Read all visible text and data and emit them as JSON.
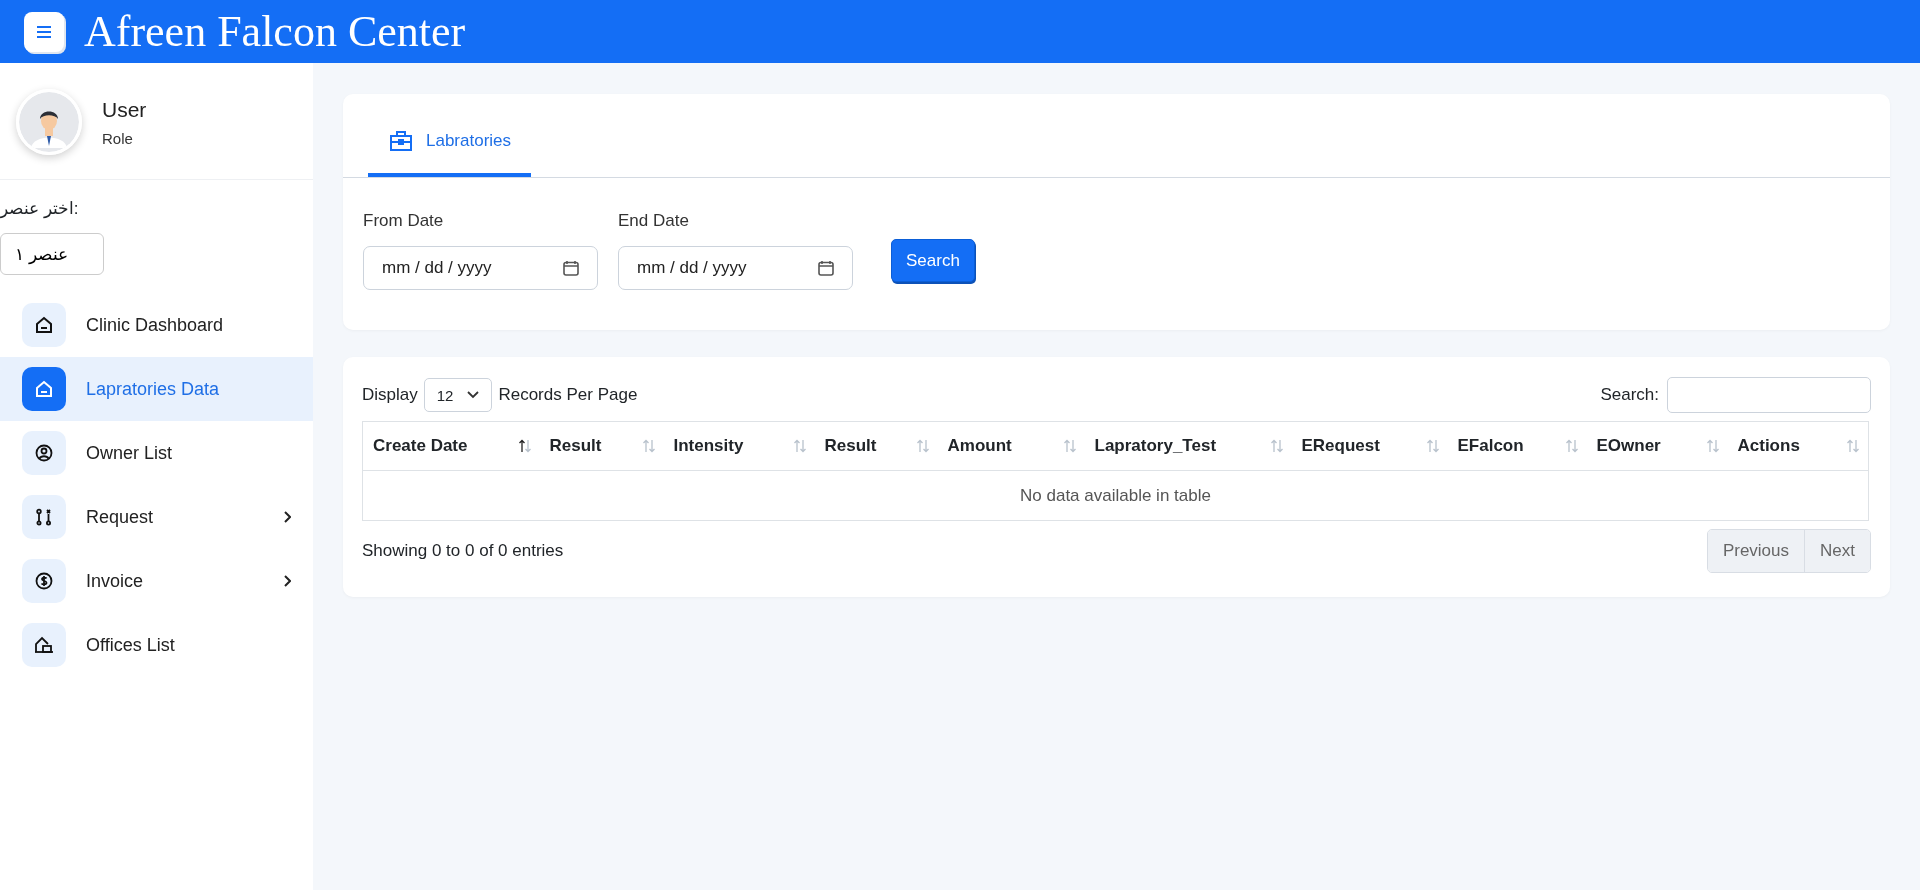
{
  "header": {
    "title": "Afreen Falcon Center"
  },
  "user": {
    "name": "User",
    "role": "Role"
  },
  "picker": {
    "label": "اختر عنصر:",
    "value": "عنصر ١"
  },
  "nav": [
    {
      "label": "Clinic Dashboard",
      "selected": false,
      "has_submenu": false
    },
    {
      "label": "Lapratories Data",
      "selected": true,
      "has_submenu": false
    },
    {
      "label": "Owner List",
      "selected": false,
      "has_submenu": false
    },
    {
      "label": "Request",
      "selected": false,
      "has_submenu": true
    },
    {
      "label": "Invoice",
      "selected": false,
      "has_submenu": true
    },
    {
      "label": "Offices List",
      "selected": false,
      "has_submenu": false
    }
  ],
  "tabs": [
    {
      "label": "Labratories",
      "selected": true
    }
  ],
  "filters": [
    {
      "label": "From Date",
      "placeholder": "mm / dd / yyyy"
    },
    {
      "label": "End Date",
      "placeholder": "mm / dd / yyyy"
    }
  ],
  "search_button": "Search",
  "table": {
    "length_prefix": "Display",
    "page_length": "12",
    "length_suffix": "Records Per Page",
    "search_label": "Search:",
    "columns": [
      {
        "label": "Create Date",
        "sorted_ascending": true
      },
      {
        "label": "Result",
        "sorted_ascending": false
      },
      {
        "label": "Intensity",
        "sorted_ascending": false
      },
      {
        "label": "Result",
        "sorted_ascending": false
      },
      {
        "label": "Amount",
        "sorted_ascending": false
      },
      {
        "label": "Lapratory_Test",
        "sorted_ascending": false
      },
      {
        "label": "ERequest",
        "sorted_ascending": false
      },
      {
        "label": "EFalcon",
        "sorted_ascending": false
      },
      {
        "label": "EOwner",
        "sorted_ascending": false
      },
      {
        "label": "Actions",
        "sorted_ascending": false
      }
    ],
    "empty_message": "No data available in table",
    "info": "Showing 0 to 0 of 0 entries",
    "pagination": [
      {
        "label": "Previous",
        "disabled": true
      },
      {
        "label": "Next",
        "disabled": true
      }
    ]
  }
}
